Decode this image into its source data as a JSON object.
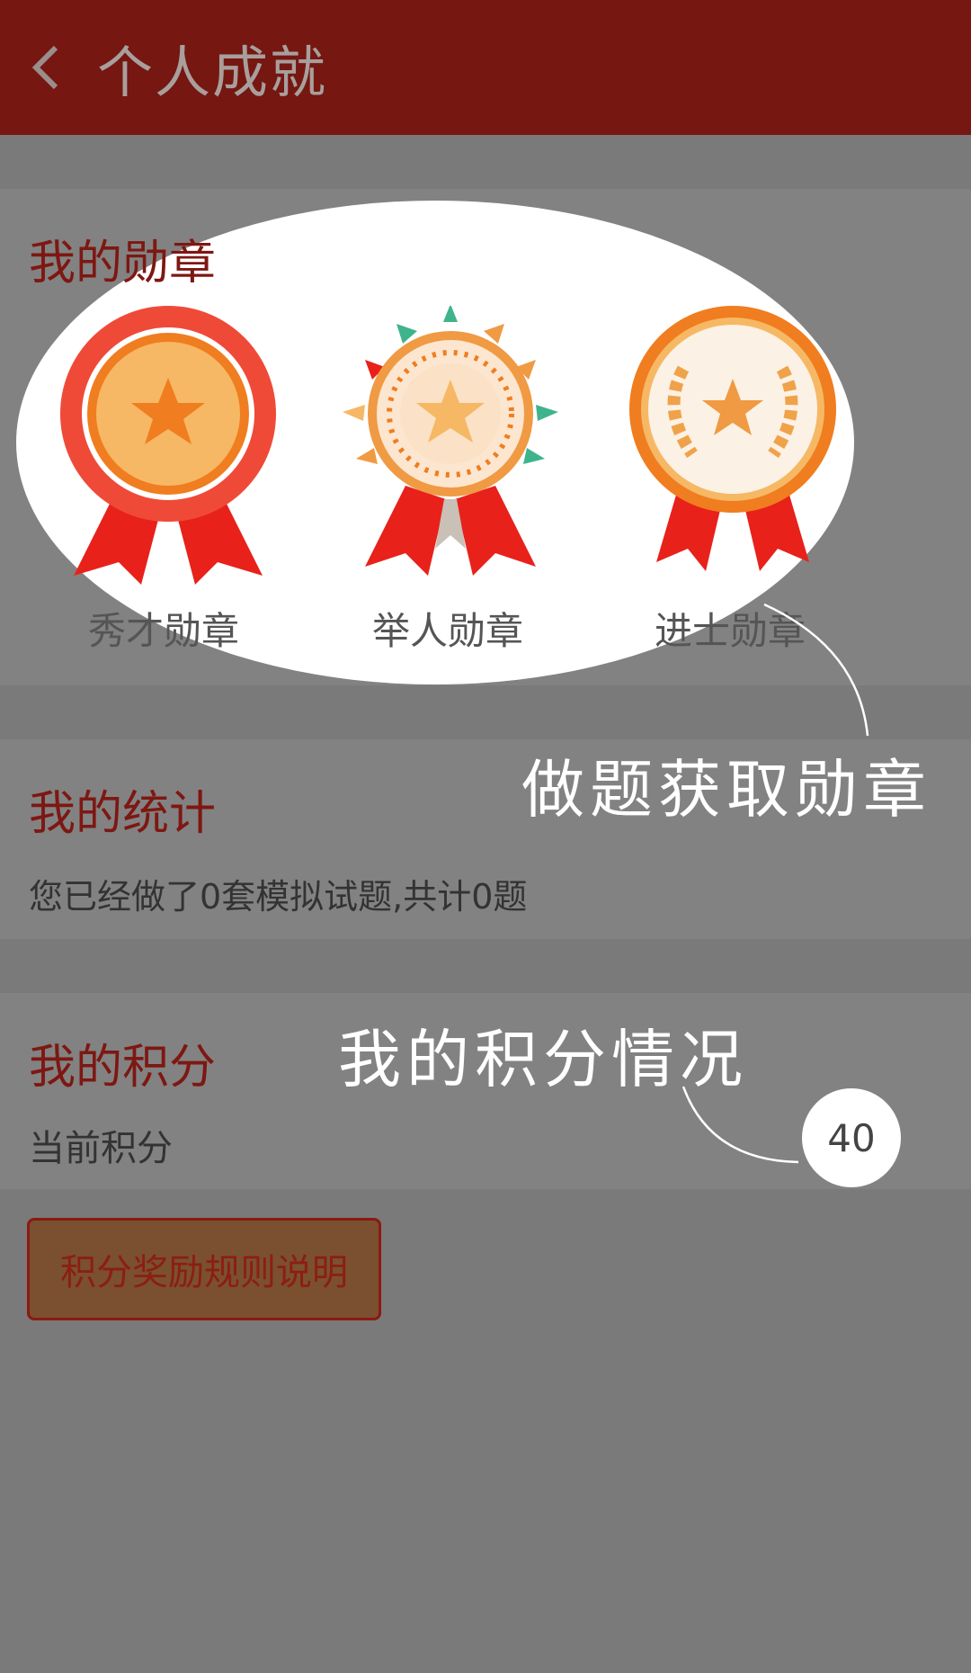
{
  "header": {
    "back_icon": "chevron-left-icon",
    "title": "个人成就"
  },
  "badges_section": {
    "title": "我的勋章",
    "items": [
      {
        "label": "秀才勋章",
        "icon": "xiucai-medal-icon"
      },
      {
        "label": "举人勋章",
        "icon": "juren-medal-icon"
      },
      {
        "label": "进士勋章",
        "icon": "jinshi-medal-icon"
      }
    ]
  },
  "stats_section": {
    "title": "我的统计",
    "summary": "您已经做了0套模拟试题,共计0题"
  },
  "points_section": {
    "title": "我的积分",
    "current_label": "当前积分",
    "current_value": "40"
  },
  "rules_button": {
    "label": "积分奖励规则说明"
  },
  "annotations": {
    "badges_callout": "做题获取勋章",
    "points_callout": "我的积分情况"
  },
  "colors": {
    "header_bg": "#761711",
    "accent": "#7e1712",
    "overlay_bg": "#7a7a7a"
  }
}
